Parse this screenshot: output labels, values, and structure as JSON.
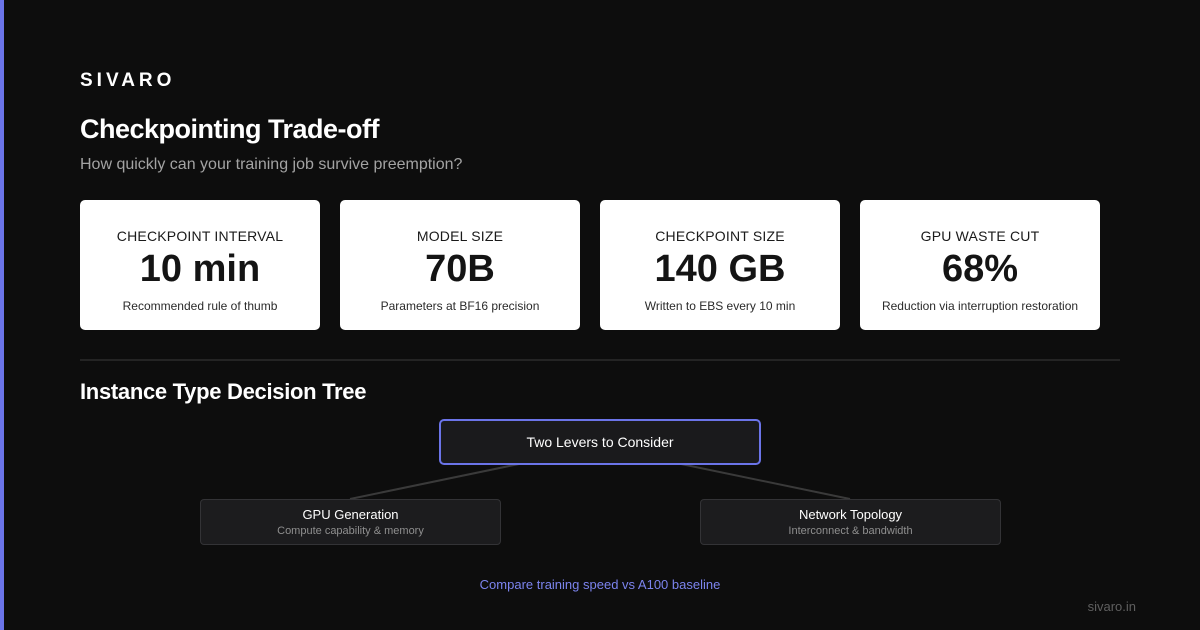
{
  "brand": "SIVARO",
  "title": "Checkpointing Trade-off",
  "subtitle": "How quickly can your training job survive preemption?",
  "stats": [
    {
      "label": "CHECKPOINT INTERVAL",
      "value": "10 min",
      "note": "Recommended rule of thumb"
    },
    {
      "label": "MODEL SIZE",
      "value": "70B",
      "note": "Parameters at BF16 precision"
    },
    {
      "label": "CHECKPOINT SIZE",
      "value": "140 GB",
      "note": "Written to EBS every 10 min"
    },
    {
      "label": "GPU WASTE CUT",
      "value": "68%",
      "note": "Reduction via interruption restoration"
    }
  ],
  "tree": {
    "section_title": "Instance Type Decision Tree",
    "root": "Two Levers to Consider",
    "left": {
      "title": "GPU Generation",
      "subtitle": "Compute capability & memory"
    },
    "right": {
      "title": "Network Topology",
      "subtitle": "Interconnect & bandwidth"
    }
  },
  "compare_link": "Compare training speed vs A100 baseline",
  "footer_url": "sivaro.in",
  "colors": {
    "accent": "#6b74e8",
    "background": "#0d0d0d",
    "link": "#7c84ee"
  }
}
